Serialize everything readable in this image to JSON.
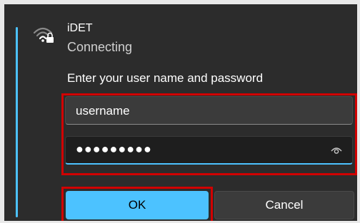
{
  "network": {
    "name": "iDET",
    "status": "Connecting",
    "icon": "wifi-secured-icon"
  },
  "form": {
    "prompt": "Enter your user name and password",
    "username_value": "username",
    "password_mask": "●●●●●●●●●",
    "reveal_icon": "eye-icon"
  },
  "buttons": {
    "ok_label": "OK",
    "cancel_label": "Cancel"
  },
  "colors": {
    "accent": "#4cc2ff",
    "panel_background": "#2c2c2c",
    "highlight": "#d10000"
  }
}
